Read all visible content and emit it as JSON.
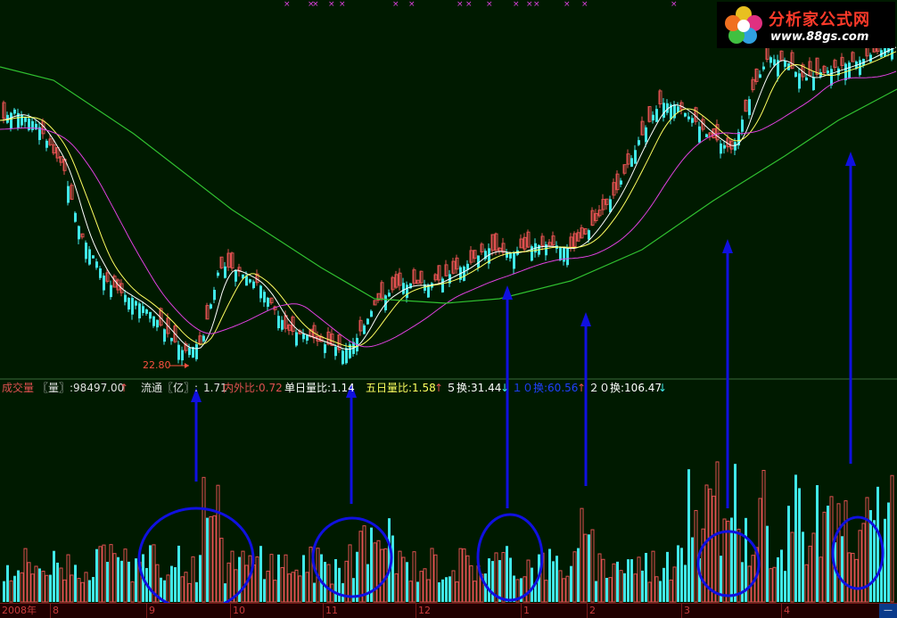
{
  "logo": {
    "cn": "分析家公式网",
    "url": "www.88gs.com"
  },
  "price_panel": {
    "low_marker": "22.80"
  },
  "info_bar": {
    "vol_label": "成交量",
    "vol_value": "〖量〗:98497.00",
    "vol_arrow": "↑",
    "float_label": "流通〖亿〗:",
    "float_value": "1.71",
    "inout_ratio": "内外比:0.72",
    "day_ratio": "单日量比:1.14",
    "five_day_ratio": "五日量比:1.58",
    "five_day_arrow": "↑",
    "turn5": "５换:31.44",
    "turn5_arrow": "↓",
    "turn10": "１０换:60.56",
    "turn10_arrow": "↑",
    "turn20": "２０换:106.47",
    "turn20_arrow": "↓"
  },
  "time_axis": {
    "labels": [
      "2008年",
      "8",
      "9",
      "10",
      "11",
      "12",
      "1",
      "2",
      "3",
      "4"
    ],
    "end_button": "—"
  },
  "colors": {
    "background": "#001a00",
    "up_candle": "#e05050",
    "down_candle": "#40e8e8",
    "ma_fast": "#ffffff",
    "ma_mid": "#ffff60",
    "ma_slow": "#e040e0",
    "ma_long": "#30c030",
    "annotation": "#1010e0",
    "top_marks": "#e040e0"
  },
  "chart_data": {
    "type": "candlestick+volume",
    "price": {
      "low_point": 22.8,
      "moving_averages": [
        "white",
        "yellow",
        "magenta",
        "green"
      ]
    },
    "volume": {
      "current_volume": 98497.0,
      "float_shares_100m": 1.71,
      "in_out_ratio": 0.72,
      "day_volume_ratio": 1.14,
      "five_day_volume_ratio": 1.58,
      "turnover_5": 31.44,
      "turnover_10": 60.56,
      "turnover_20": 106.47
    },
    "annotations": {
      "arrows": 6,
      "circles": 5
    },
    "x_labels": [
      "2008年",
      "8",
      "9",
      "10",
      "11",
      "12",
      "1",
      "2",
      "3",
      "4"
    ]
  }
}
